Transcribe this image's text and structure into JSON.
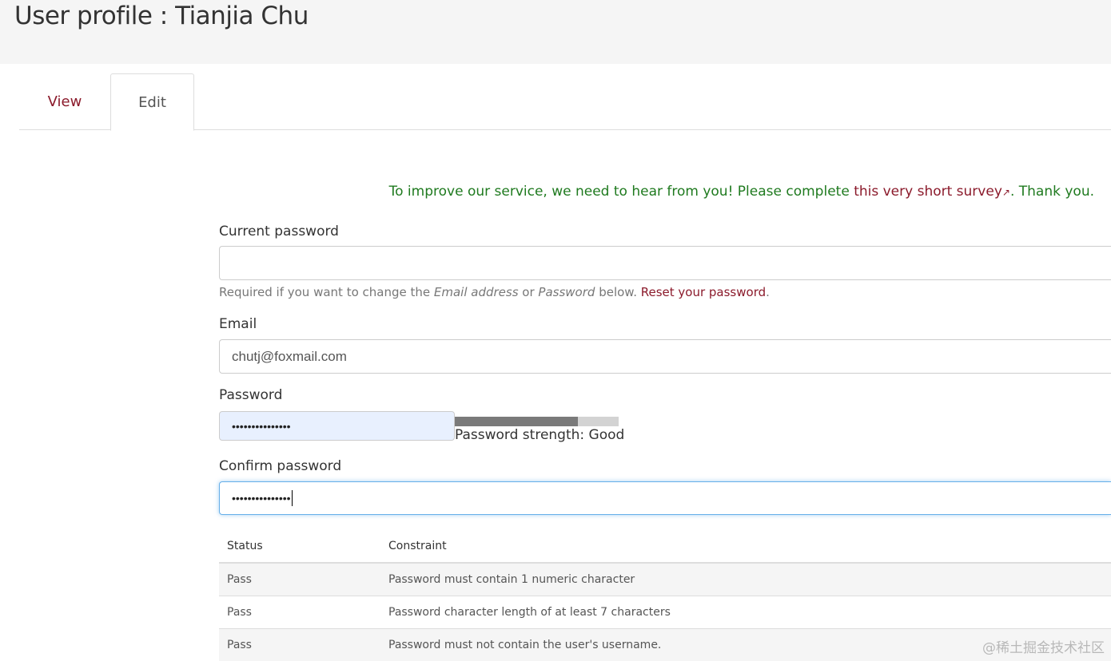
{
  "header": {
    "title": "User profile : Tianjia Chu"
  },
  "tabs": [
    {
      "label": "View"
    },
    {
      "label": "Edit"
    }
  ],
  "survey": {
    "prefix": "To improve our service, we need to hear from you! Please complete ",
    "link": "this very short survey",
    "icon": "external-link-icon",
    "suffix": ". Thank you."
  },
  "form": {
    "current_password": {
      "label": "Current password",
      "value": ""
    },
    "help": {
      "t1": "Required if you want to change the ",
      "em1": "Email address",
      "t2": " or ",
      "em2": "Password",
      "t3": " below. ",
      "link": "Reset your password",
      "t4": "."
    },
    "email": {
      "label": "Email",
      "value": "chutj@foxmail.com"
    },
    "password": {
      "label": "Password",
      "value": "•••••••••••••••"
    },
    "strength": {
      "text": "Password strength: Good",
      "level": 0.75
    },
    "confirm_password": {
      "label": "Confirm password",
      "value": "•••••••••••••••"
    }
  },
  "constraints": {
    "headers": [
      "Status",
      "Constraint"
    ],
    "rows": [
      {
        "status": "Pass",
        "constraint": "Password must contain 1 numeric character"
      },
      {
        "status": "Pass",
        "constraint": "Password character length of at least 7 characters"
      },
      {
        "status": "Pass",
        "constraint": "Password must not contain the user's username."
      }
    ]
  },
  "watermark": "@稀土掘金技术社区",
  "colors": {
    "link": "#8b1a2b",
    "survey": "#1f7a1f",
    "focus": "#66afe9"
  }
}
